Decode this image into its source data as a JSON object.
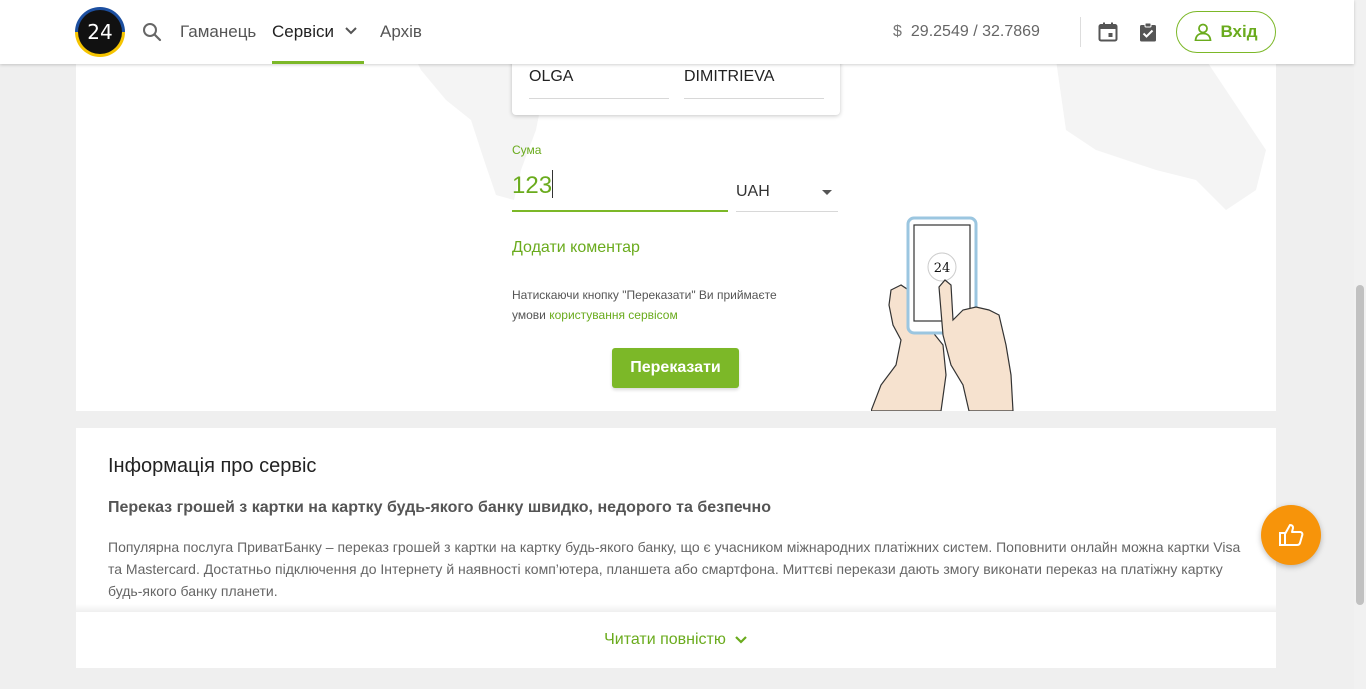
{
  "header": {
    "logo_text": "24",
    "nav": {
      "wallet": "Гаманець",
      "services": "Сервіси",
      "archive": "Архів"
    },
    "rate": {
      "currency_symbol": "$",
      "value": "29.2549 / 32.7869"
    },
    "login_label": "Вхід",
    "icons": [
      "search-icon",
      "chevron-down-icon",
      "calendar-icon",
      "clipboard-check-icon",
      "user-icon"
    ]
  },
  "form": {
    "first_name": "OLGA",
    "last_name": "DIMITRIEVA",
    "sum_label": "Сума",
    "sum_value": "123",
    "currency": "UAH",
    "add_comment": "Додати коментар",
    "terms_text": "Натискаючи кнопку \"Переказати\" Ви приймаєте умови",
    "terms_link": "користування сервісом",
    "transfer_button": "Переказати",
    "illustration_text": "24"
  },
  "info": {
    "title": "Інформація про сервіс",
    "subtitle": "Переказ грошей з картки на картку будь-якого банку швидко, недорого та безпечно",
    "text": "Популярна послуга ПриватБанку – переказ грошей з картки на картку будь-якого банку, що є учасником міжнародних платіжних систем. Поповнити онлайн можна картки Visa та Mastercard. Достатньо підключення до Інтернету й наявності комп’ютера, планшета або смартфона. Миттєві перекази дають змогу виконати переказ на платіжну картку будь-якого банку планети.",
    "read_more": "Читати повністю"
  },
  "colors": {
    "accent_green": "#7cb828",
    "feedback_orange": "#f7940a"
  }
}
